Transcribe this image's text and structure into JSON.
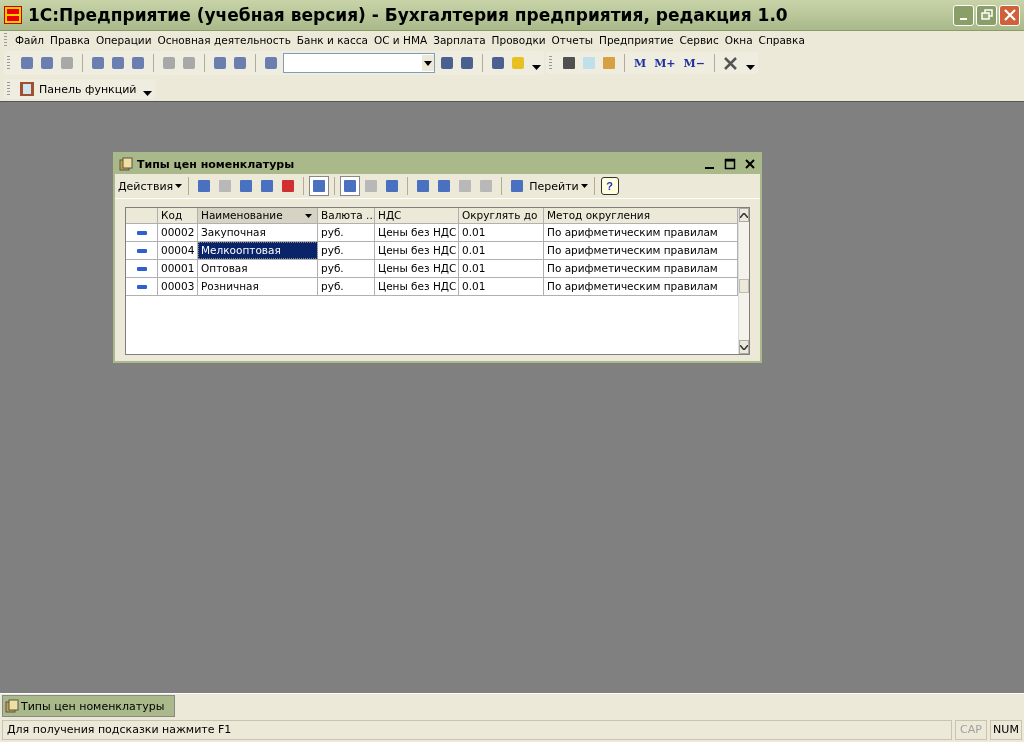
{
  "window": {
    "title": "1С:Предприятие (учебная версия) - Бухгалтерия предприятия, редакция 1.0"
  },
  "menu": [
    "Файл",
    "Правка",
    "Операции",
    "Основная деятельность",
    "Банк и касса",
    "ОС и НМА",
    "Зарплата",
    "Проводки",
    "Отчеты",
    "Предприятие",
    "Сервис",
    "Окна",
    "Справка"
  ],
  "toolbar": {
    "memory_buttons": [
      "M",
      "M+",
      "M−"
    ]
  },
  "function_panel": {
    "label": "Панель функций"
  },
  "child_window": {
    "title": "Типы цен номенклатуры",
    "actions_label": "Действия",
    "goto_label": "Перейти",
    "help_label": "?",
    "table": {
      "columns": [
        {
          "label": "Код",
          "sorted": false
        },
        {
          "label": "Наименование",
          "sorted": true
        },
        {
          "label": "Валюта ...",
          "sorted": false
        },
        {
          "label": "НДС",
          "sorted": false
        },
        {
          "label": "Округлять до",
          "sorted": false
        },
        {
          "label": "Метод округления",
          "sorted": false
        }
      ],
      "rows": [
        {
          "cells": [
            "00002",
            "Закупочная",
            "руб.",
            "Цены без НДС",
            "0.01",
            "По арифметическим правилам"
          ],
          "selected": false
        },
        {
          "cells": [
            "00004",
            "Мелкооптовая",
            "руб.",
            "Цены без НДС",
            "0.01",
            "По арифметическим правилам"
          ],
          "selected": true
        },
        {
          "cells": [
            "00001",
            "Оптовая",
            "руб.",
            "Цены без НДС",
            "0.01",
            "По арифметическим правилам"
          ],
          "selected": false
        },
        {
          "cells": [
            "00003",
            "Розничная",
            "руб.",
            "Цены без НДС",
            "0.01",
            "По арифметическим правилам"
          ],
          "selected": false
        }
      ]
    }
  },
  "taskbar": [
    {
      "label": "Типы цен номенклатуры",
      "selected": true
    }
  ],
  "status_bar": {
    "hint": "Для получения подсказки нажмите F1",
    "indicators": [
      {
        "label": "CAP",
        "on": false
      },
      {
        "label": "NUM",
        "on": true
      }
    ]
  }
}
